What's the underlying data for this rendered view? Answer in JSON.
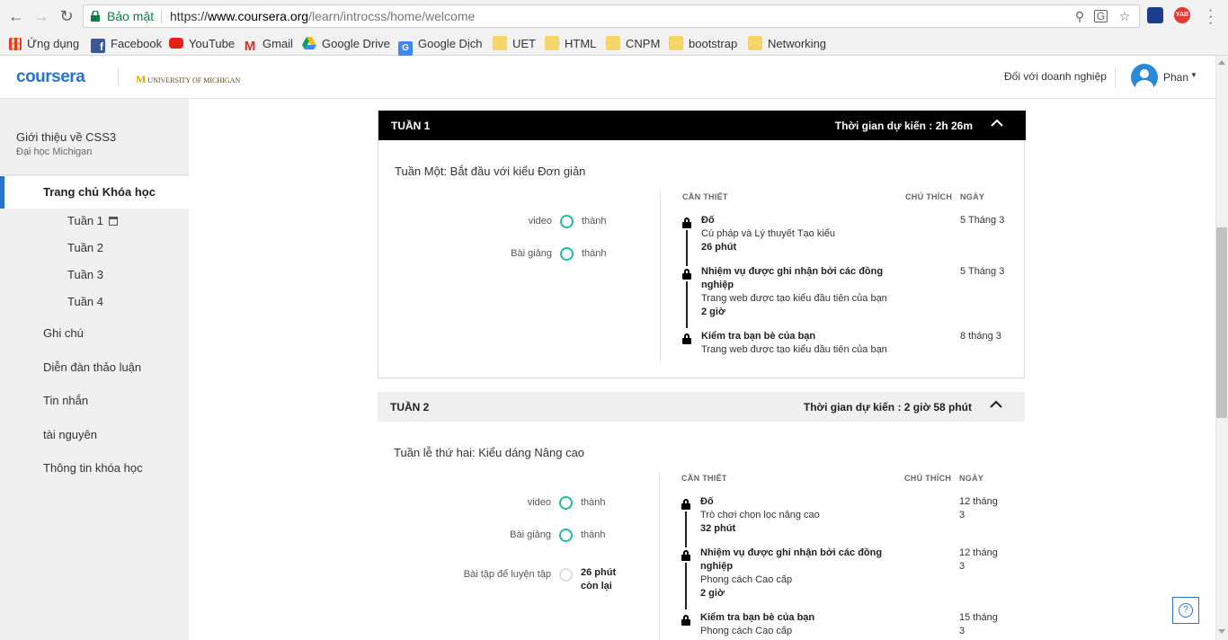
{
  "browser": {
    "secure_label": "Bảo mật",
    "url_scheme": "https://",
    "url_host": "www.coursera.org",
    "url_path": "/learn/introcss/home/welcome",
    "ext_label": "YAB",
    "bookmarks": [
      {
        "label": "Ứng dụng",
        "icon": "apps-grid-icon"
      },
      {
        "label": "Facebook",
        "icon": "facebook-icon"
      },
      {
        "label": "YouTube",
        "icon": "youtube-icon"
      },
      {
        "label": "Gmail",
        "icon": "gmail-icon"
      },
      {
        "label": "Google Drive",
        "icon": "google-drive-icon"
      },
      {
        "label": "Google Dịch",
        "icon": "google-translate-icon"
      },
      {
        "label": "UET",
        "icon": "folder-icon"
      },
      {
        "label": "HTML",
        "icon": "folder-icon"
      },
      {
        "label": "CNPM",
        "icon": "folder-icon"
      },
      {
        "label": "bootstrap",
        "icon": "folder-icon"
      },
      {
        "label": "Networking",
        "icon": "folder-icon"
      }
    ]
  },
  "header": {
    "logo": "coursera",
    "partner_mark": "M",
    "partner_name": "UNIVERSITY OF MICHIGAN",
    "business_link": "Đối với doanh nghiệp",
    "user_name": "Phan"
  },
  "sidebar": {
    "course_title": "Giới thiệu về CSS3",
    "course_org": "Đại học Michigan",
    "home_label": "Trang chủ Khóa học",
    "weeks": [
      "Tuần 1",
      "Tuần 2",
      "Tuần 3",
      "Tuần 4"
    ],
    "items": [
      "Ghi chú",
      "Diễn đàn thảo luận",
      "Tin nhắn",
      "tài nguyên",
      "Thông tin khóa học"
    ]
  },
  "columns": {
    "required": "CẦN THIẾT",
    "notes": "CHÚ THÍCH",
    "date": "NGÀY"
  },
  "week1": {
    "label": "TUẦN 1",
    "estimate": "Thời gian dự kiến : 2h 26m",
    "description": "Tuần Một: Bắt đầu với kiểu Đơn giản",
    "progress": [
      {
        "label": "video",
        "value": "thành"
      },
      {
        "label": "Bài giảng",
        "value": "thành"
      }
    ],
    "items": [
      {
        "title": "Đố",
        "subtitle": "Cú pháp và Lý thuyết Tạo kiểu",
        "duration": "26 phút",
        "date": "5 Tháng 3"
      },
      {
        "title": "Nhiệm vụ được ghi nhận bởi các đồng nghiệp",
        "subtitle": "Trang web được tạo kiểu đầu tiên của bạn",
        "duration": "2 giờ",
        "date": "5 Tháng 3"
      },
      {
        "title": "Kiểm tra bạn bè của bạn",
        "subtitle": "Trang web được tạo kiểu đầu tiên của bạn",
        "duration": "",
        "date": "8 tháng 3"
      }
    ]
  },
  "week2": {
    "label": "TUẦN 2",
    "estimate": "Thời gian dự kiến : 2 giờ 58 phút",
    "description": "Tuần lễ thứ hai: Kiểu dáng Nâng cao",
    "progress": [
      {
        "label": "video",
        "value": "thành"
      },
      {
        "label": "Bài giảng",
        "value": "thành"
      },
      {
        "label": "Bài tập để luyện tập",
        "value_line1": "26 phút",
        "value_line2": "còn lại"
      }
    ],
    "items": [
      {
        "title": "Đố",
        "subtitle": "Trò chơi chọn lọc nâng cao",
        "duration": "32 phút",
        "date_line1": "12 tháng",
        "date_line2": "3"
      },
      {
        "title": "Nhiệm vụ được ghi nhận bởi các đồng nghiệp",
        "subtitle": "Phong cách Cao cấp",
        "duration": "2 giờ",
        "date_line1": "12 tháng",
        "date_line2": "3"
      },
      {
        "title": "Kiểm tra bạn bè của bạn",
        "subtitle": "Phong cách Cao cấp",
        "duration": "",
        "date_line1": "15 tháng",
        "date_line2": "3"
      }
    ]
  },
  "help": {
    "label": "?"
  },
  "colors": {
    "brand": "#2a73cc",
    "progress_ring": "#1fbb9c",
    "week1_header": "#000000",
    "week2_header": "#f0f0f0"
  }
}
